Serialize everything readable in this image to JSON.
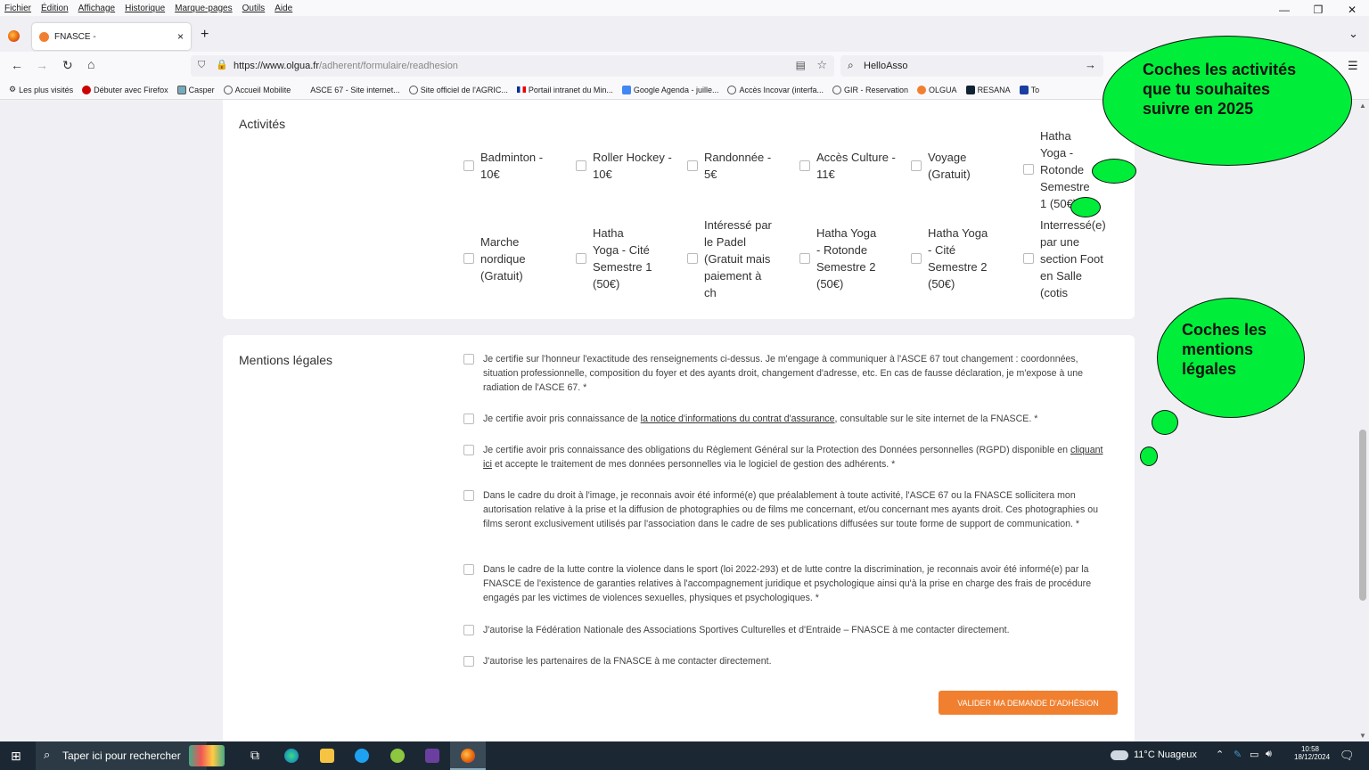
{
  "menu": [
    "Fichier",
    "Édition",
    "Affichage",
    "Historique",
    "Marque-pages",
    "Outils",
    "Aide"
  ],
  "tab": {
    "title": "FNASCE -",
    "close": "×",
    "new": "+"
  },
  "nav": {
    "back": "←",
    "forward": "→",
    "reload": "↻",
    "home": "⌂",
    "url_host": "https://www.olgua.fr",
    "url_path": "/adherent/formulaire/readhesion",
    "search_value": "HelloAsso",
    "go": "→"
  },
  "bookmarks": [
    "Les plus visités",
    "Débuter avec Firefox",
    "Casper",
    "Accueil Mobilite",
    "ASCE 67 - Site internet...",
    "Site officiel de l'AGRIC...",
    "Portail intranet du Min...",
    "Google Agenda - juille...",
    "Accès Incovar (interfa...",
    "GIR - Reservation",
    "OLGUA",
    "RESANA",
    "To"
  ],
  "activites": {
    "title": "Activités",
    "items": [
      "Badminton - 10€",
      "Roller Hockey - 10€",
      "Randonnée - 5€",
      "Accès Culture - 11€",
      "Voyage (Gratuit)",
      "Hatha Yoga - Rotonde Semestre 1 (50€)",
      "Marche nordique (Gratuit)",
      "Hatha Yoga - Cité Semestre 1 (50€)",
      "Intéressé par le Padel (Gratuit mais paiement à ch",
      "Hatha Yoga - Rotonde Semestre 2 (50€)",
      "Hatha Yoga - Cité Semestre 2 (50€)",
      "Interressé(e) par une section Foot en Salle (cotis"
    ]
  },
  "mentions": {
    "title": "Mentions légales",
    "m1": "Je certifie sur l'honneur l'exactitude des renseignements ci-dessus. Je m'engage à communiquer à l'ASCE 67 tout changement : coordonnées, situation professionnelle, composition du foyer et des ayants droit, changement d'adresse, etc. En cas de fausse déclaration, je m'expose à une radiation de l'ASCE 67. *",
    "m2a": "Je certifie avoir pris connaissance de ",
    "m2link": "la notice d'informations du contrat d'assurance",
    "m2b": ", consultable sur le site internet de la FNASCE. *",
    "m3a": "Je certifie avoir pris connaissance des obligations du Règlement Général sur la Protection des Données personnelles (RGPD) disponible en ",
    "m3link": "cliquant ici",
    "m3b": " et accepte le traitement de mes données personnelles via le logiciel de gestion des adhérents. *",
    "m4": "Dans le cadre du droit à l'image, je reconnais avoir été informé(e) que préalablement à toute activité, l'ASCE 67 ou la FNASCE sollicitera mon autorisation relative à la prise et la diffusion de photographies ou de films me concernant, et/ou concernant mes ayants droit. Ces photographies ou films seront exclusivement utilisés par l'association dans le cadre de ses publications diffusées sur toute forme de support de communication. *",
    "m5": "Dans le cadre de la lutte contre la violence dans le sport (loi 2022-293) et de lutte contre la discrimination, je reconnais avoir été informé(e) par la FNASCE de l'existence de garanties relatives à l'accompagnement juridique et psychologique ainsi qu'à la prise en charge des frais de procédure engagés par les victimes de violences sexuelles, physiques et psychologiques. *",
    "m6": "J'autorise la Fédération Nationale des Associations Sportives Culturelles et d'Entraide – FNASCE à me contacter directement.",
    "m7": "J'autorise les partenaires de la FNASCE à me contacter directement."
  },
  "submit": "VALIDER MA DEMANDE D'ADHÉSION",
  "bubble1": "Coches les activités que tu souhaites suivre en 2025",
  "bubble2": "Coches  les mentions légales",
  "taskbar": {
    "search": "Taper ici pour rechercher",
    "weather": "11°C  Nuageux",
    "time": "10:58",
    "date": "18/12/2024"
  },
  "colors": {
    "accent": "#f08030",
    "bubble": "#00ee3a"
  }
}
